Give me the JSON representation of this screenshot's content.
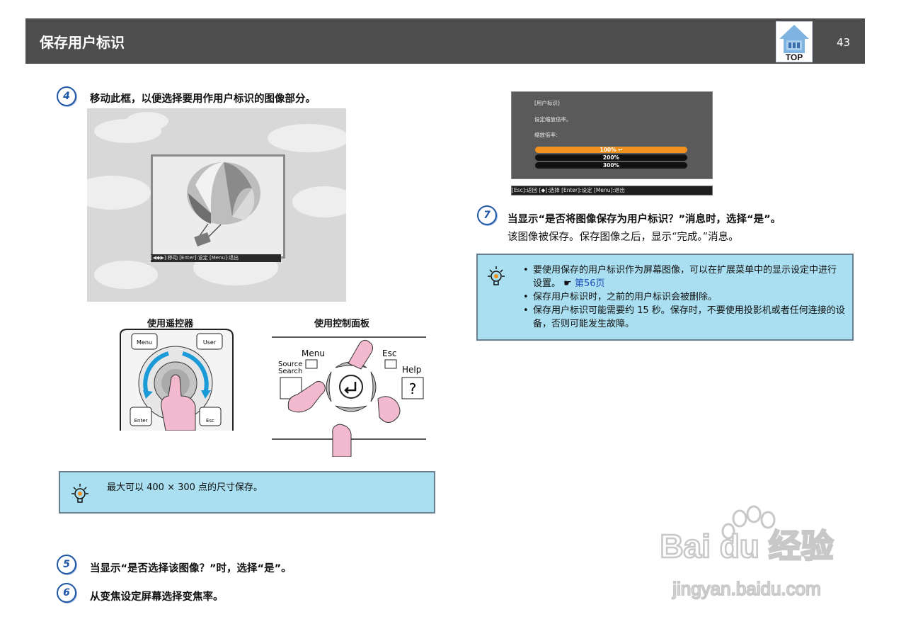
{
  "header": {
    "title": "保存用户标识",
    "top_label": "TOP",
    "page_number": "43"
  },
  "steps": {
    "s4": {
      "num": "4",
      "text": "移动此框，以便选择要用作用户标识的图像部分。"
    },
    "s5": {
      "num": "5",
      "text": "当显示“是否选择该图像？”时，选择“是”。"
    },
    "s6": {
      "num": "6",
      "text": "从变焦设定屏幕选择变焦率。"
    },
    "s7": {
      "num": "7",
      "text": "当显示“是否将图像保存为用户标识？”消息时，选择“是”。",
      "sub": "该图像被保存。保存图像之后，显示“完成。”消息。"
    }
  },
  "balloon_bar": "[◀◆▶]:移动 [Enter]:设定      [Menu]:退出",
  "remote": {
    "caption": "使用遥控器",
    "labels": {
      "menu": "Menu",
      "user": "User",
      "enter": "Enter",
      "esc": "Esc"
    }
  },
  "panel": {
    "caption": "使用控制面板",
    "labels": {
      "menu": "Menu",
      "source1": "Source",
      "source2": "Search",
      "esc": "Esc",
      "help": "Help",
      "help_btn": "?"
    }
  },
  "note_left": "最大可以 400 × 300 点的尺寸保存。",
  "screen": {
    "title": "[用户标识]",
    "line1": "设定缩放倍率。",
    "line2": "缩放倍率:",
    "options": [
      "100% ↩",
      "200%",
      "300%"
    ],
    "bar": "[Esc]:返回 [◆]:选择 [Enter]:设定            [Menu]:退出"
  },
  "note_right": {
    "b1a": "要使用保存的用户标识作为屏幕图像，可以在扩展菜单中的显示设定中进行设置。",
    "b1_ref": "第56页",
    "b2": "保存用户标识时，之前的用户标识会被删除。",
    "b3": "保存用户标识可能需要约 15 秒。保存时，不要使用投影机或者任何连接的设备，否则可能发生故障。"
  },
  "watermark": {
    "brand": "Bai du 经验",
    "url": "jingyan.baidu.com"
  },
  "colors": {
    "header_bg": "#4d4d4d",
    "note_bg": "#a9dff0",
    "step_blue": "#1e56a8",
    "accent_orange": "#f0901d"
  }
}
